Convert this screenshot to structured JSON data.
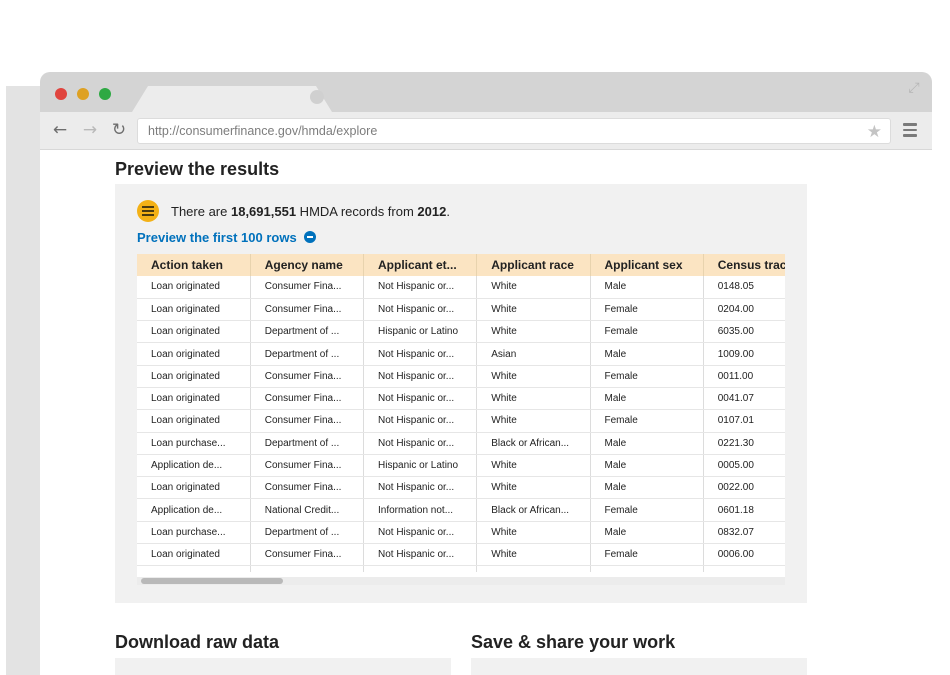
{
  "browser": {
    "url": "http://consumerfinance.gov/hmda/explore"
  },
  "preview": {
    "title": "Preview the results",
    "records_prefix": "There are ",
    "records_count": "18,691,551",
    "records_middle": " HMDA records from ",
    "records_year": "2012",
    "records_suffix": ".",
    "toggle_label": "Preview the first 100 rows",
    "icon": "table-icon",
    "columns": [
      "Action taken",
      "Agency name",
      "Applicant et...",
      "Applicant race",
      "Applicant sex",
      "Census tract"
    ],
    "rows": [
      [
        "Loan originated",
        "Consumer Fina...",
        "Not Hispanic or...",
        "White",
        "Male",
        "0148.05"
      ],
      [
        "Loan originated",
        "Consumer Fina...",
        "Not Hispanic or...",
        "White",
        "Female",
        "0204.00"
      ],
      [
        "Loan originated",
        "Department of ...",
        "Hispanic or Latino",
        "White",
        "Female",
        "6035.00"
      ],
      [
        "Loan originated",
        "Department of ...",
        "Not Hispanic or...",
        "Asian",
        "Male",
        "1009.00"
      ],
      [
        "Loan originated",
        "Consumer Fina...",
        "Not Hispanic or...",
        "White",
        "Female",
        "0011.00"
      ],
      [
        "Loan originated",
        "Consumer Fina...",
        "Not Hispanic or...",
        "White",
        "Male",
        "0041.07"
      ],
      [
        "Loan originated",
        "Consumer Fina...",
        "Not Hispanic or...",
        "White",
        "Female",
        "0107.01"
      ],
      [
        "Loan purchase...",
        "Department of ...",
        "Not Hispanic or...",
        "Black or African...",
        "Male",
        "0221.30"
      ],
      [
        "Application de...",
        "Consumer Fina...",
        "Hispanic or Latino",
        "White",
        "Male",
        "0005.00"
      ],
      [
        "Loan originated",
        "Consumer Fina...",
        "Not Hispanic or...",
        "White",
        "Male",
        "0022.00"
      ],
      [
        "Application de...",
        "National Credit...",
        "Information not...",
        "Black or African...",
        "Female",
        "0601.18"
      ],
      [
        "Loan purchase...",
        "Department of ...",
        "Not Hispanic or...",
        "White",
        "Male",
        "0832.07"
      ],
      [
        "Loan originated",
        "Consumer Fina...",
        "Not Hispanic or...",
        "White",
        "Female",
        "0006.00"
      ]
    ]
  },
  "download": {
    "title": "Download raw data"
  },
  "share": {
    "title": "Save & share your work"
  },
  "colors": {
    "link": "#0071bc",
    "header_bg": "#fbe4c2",
    "icon_accent": "#f3b116"
  }
}
